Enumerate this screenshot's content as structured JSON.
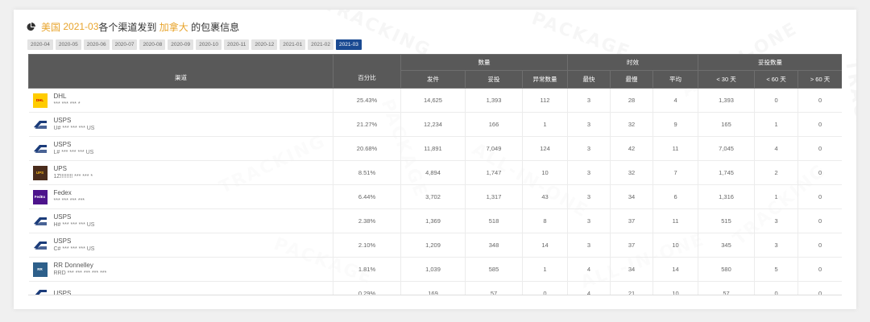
{
  "title": {
    "country": "美国",
    "month": "2021-03",
    "mid": "各个渠道发到",
    "dest": "加拿大",
    "suffix": " 的包裹信息"
  },
  "tabs": [
    "2020-04",
    "2020-05",
    "2020-06",
    "2020-07",
    "2020-08",
    "2020-09",
    "2020-10",
    "2020-11",
    "2020-12",
    "2021-01",
    "2021-02",
    "2021-03"
  ],
  "active_tab": "2021-03",
  "headers": {
    "channel": "渠道",
    "percent": "百分比",
    "qty_group": "数量",
    "time_group": "时效",
    "delivered_group": "妥投数量",
    "sent": "发件",
    "delivered": "妥投",
    "abnormal": "异常数量",
    "fastest": "最快",
    "slowest": "最慢",
    "average": "平均",
    "lt30": "< 30 天",
    "lt60": "< 60 天",
    "gt60": "> 60 天"
  },
  "rows": [
    {
      "logo": "dhl",
      "logo_text": "DHL",
      "name": "DHL",
      "tracking": "*** *** *** *",
      "percent": "25.43%",
      "sent": "14,625",
      "delivered": "1,393",
      "abnormal": "112",
      "fastest": "3",
      "slowest": "28",
      "average": "4",
      "lt30": "1,393",
      "lt60": "0",
      "gt60": "0"
    },
    {
      "logo": "usps",
      "logo_text": "",
      "name": "USPS",
      "tracking": "U# *** *** *** US",
      "percent": "21.27%",
      "sent": "12,234",
      "delivered": "166",
      "abnormal": "1",
      "fastest": "3",
      "slowest": "32",
      "average": "9",
      "lt30": "165",
      "lt60": "1",
      "gt60": "0"
    },
    {
      "logo": "usps",
      "logo_text": "",
      "name": "USPS",
      "tracking": "L# *** *** *** US",
      "percent": "20.68%",
      "sent": "11,891",
      "delivered": "7,049",
      "abnormal": "124",
      "fastest": "3",
      "slowest": "42",
      "average": "11",
      "lt30": "7,045",
      "lt60": "4",
      "gt60": "0"
    },
    {
      "logo": "ups",
      "logo_text": "UPS",
      "name": "UPS",
      "tracking": "1Z!!!!!!!! *** *** *",
      "percent": "8.51%",
      "sent": "4,894",
      "delivered": "1,747",
      "abnormal": "10",
      "fastest": "3",
      "slowest": "32",
      "average": "7",
      "lt30": "1,745",
      "lt60": "2",
      "gt60": "0"
    },
    {
      "logo": "fedex",
      "logo_text": "FedEx",
      "name": "Fedex",
      "tracking": "*** *** *** ***",
      "percent": "6.44%",
      "sent": "3,702",
      "delivered": "1,317",
      "abnormal": "43",
      "fastest": "3",
      "slowest": "34",
      "average": "6",
      "lt30": "1,316",
      "lt60": "1",
      "gt60": "0"
    },
    {
      "logo": "usps",
      "logo_text": "",
      "name": "USPS",
      "tracking": "H# *** *** *** US",
      "percent": "2.38%",
      "sent": "1,369",
      "delivered": "518",
      "abnormal": "8",
      "fastest": "3",
      "slowest": "37",
      "average": "11",
      "lt30": "515",
      "lt60": "3",
      "gt60": "0"
    },
    {
      "logo": "usps",
      "logo_text": "",
      "name": "USPS",
      "tracking": "C# *** *** *** US",
      "percent": "2.10%",
      "sent": "1,209",
      "delivered": "348",
      "abnormal": "14",
      "fastest": "3",
      "slowest": "37",
      "average": "10",
      "lt30": "345",
      "lt60": "3",
      "gt60": "0"
    },
    {
      "logo": "rr",
      "logo_text": "RR",
      "name": "RR Donnelley",
      "tracking": "RRD *** *** *** *** ***",
      "percent": "1.81%",
      "sent": "1,039",
      "delivered": "585",
      "abnormal": "1",
      "fastest": "4",
      "slowest": "34",
      "average": "14",
      "lt30": "580",
      "lt60": "5",
      "gt60": "0"
    },
    {
      "logo": "usps",
      "logo_text": "",
      "name": "USPS",
      "tracking": "",
      "percent": "0.29%",
      "sent": "169",
      "delivered": "57",
      "abnormal": "0",
      "fastest": "4",
      "slowest": "21",
      "average": "10",
      "lt30": "57",
      "lt60": "0",
      "gt60": "0"
    }
  ],
  "watermark": [
    "TRACKING",
    "PACKAGE",
    "ALL-IN-ONE"
  ],
  "colors": {
    "accent": "#e8a42c",
    "tab_active": "#1a4a92",
    "header_bg": "#595959"
  }
}
